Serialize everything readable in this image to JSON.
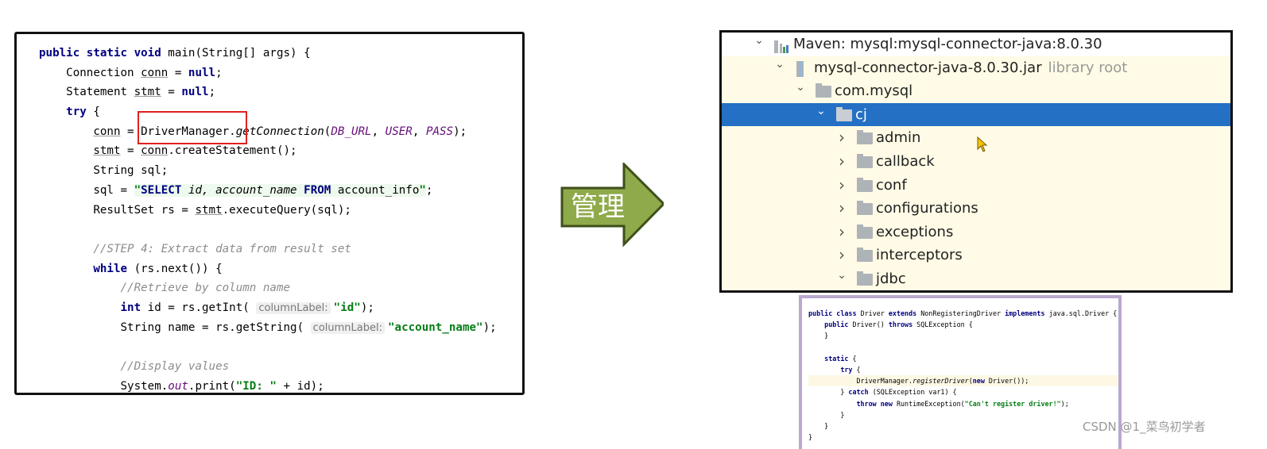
{
  "left_code": {
    "lines": [
      [
        [
          "public static void ",
          "kw"
        ],
        [
          "main(String[] args) {",
          ""
        ]
      ],
      [
        [
          "    Connection ",
          ""
        ],
        [
          "conn",
          "ul"
        ],
        [
          " = ",
          ""
        ],
        [
          "null",
          "kw"
        ],
        [
          ";",
          ""
        ]
      ],
      [
        [
          "    Statement ",
          ""
        ],
        [
          "stmt",
          "ul"
        ],
        [
          " = ",
          ""
        ],
        [
          "null",
          "kw"
        ],
        [
          ";",
          ""
        ]
      ],
      [
        [
          "    ",
          ""
        ],
        [
          "try",
          "kw"
        ],
        [
          " {",
          ""
        ]
      ],
      [
        [
          "        ",
          ""
        ],
        [
          "conn",
          "ul"
        ],
        [
          " = DriverManager.",
          ""
        ],
        [
          "getConnection",
          "it"
        ],
        [
          "(",
          ""
        ],
        [
          "DB_URL",
          "fld"
        ],
        [
          ", ",
          ""
        ],
        [
          "USER",
          "fld"
        ],
        [
          ", ",
          ""
        ],
        [
          "PASS",
          "fld"
        ],
        [
          ");",
          ""
        ]
      ],
      [
        [
          "        ",
          ""
        ],
        [
          "stmt",
          "ul"
        ],
        [
          " = ",
          ""
        ],
        [
          "conn",
          "ul"
        ],
        [
          ".createStatement();",
          ""
        ]
      ],
      [
        [
          "        String sql;",
          ""
        ]
      ],
      [
        [
          "        sql = ",
          ""
        ],
        [
          "\"",
          "strs"
        ],
        [
          "SELECT ",
          "sqlk"
        ],
        [
          "id, account_name ",
          "sqli"
        ],
        [
          "FROM ",
          "sqlk"
        ],
        [
          "account_info",
          "sqln"
        ],
        [
          "\"",
          "strs"
        ],
        [
          ";",
          ""
        ]
      ],
      [
        [
          "        ResultSet rs = ",
          ""
        ],
        [
          "stmt",
          "ul"
        ],
        [
          ".executeQuery(sql);",
          ""
        ]
      ],
      [
        [
          "",
          ""
        ]
      ],
      [
        [
          "        ",
          ""
        ],
        [
          "//STEP 4: Extract data from result set",
          "cm"
        ]
      ],
      [
        [
          "        ",
          ""
        ],
        [
          "while",
          "kw"
        ],
        [
          " (rs.next()) {",
          ""
        ]
      ],
      [
        [
          "            ",
          ""
        ],
        [
          "//Retrieve by column name",
          "cm"
        ]
      ],
      [
        [
          "            ",
          ""
        ],
        [
          "int",
          "kw"
        ],
        [
          " id = rs.getInt( ",
          ""
        ],
        [
          "columnLabel:",
          "hint"
        ],
        [
          "\"id\"",
          "str"
        ],
        [
          ");",
          ""
        ]
      ],
      [
        [
          "            String name = rs.getString( ",
          ""
        ],
        [
          "columnLabel:",
          "hint"
        ],
        [
          "\"account_name\"",
          "str"
        ],
        [
          ");",
          ""
        ]
      ],
      [
        [
          "",
          ""
        ]
      ],
      [
        [
          "            ",
          ""
        ],
        [
          "//Display values",
          "cm"
        ]
      ],
      [
        [
          "            System.",
          ""
        ],
        [
          "out",
          "fld"
        ],
        [
          ".print(",
          ""
        ],
        [
          "\"ID: \"",
          "str"
        ],
        [
          " + id);",
          ""
        ]
      ]
    ]
  },
  "arrow": {
    "label": "管理",
    "color": "#8faa4a"
  },
  "tree": {
    "rows": [
      {
        "label": "Maven: mysql:mysql-connector-java:8.0.30",
        "icon": "maven-library-icon",
        "chevron": "down",
        "level": 0
      },
      {
        "label": "mysql-connector-java-8.0.30.jar",
        "suffix": "library root",
        "icon": "jar-icon",
        "chevron": "down",
        "level": 1
      },
      {
        "label": "com.mysql",
        "icon": "folder-icon",
        "chevron": "down",
        "level": 2
      },
      {
        "label": "cj",
        "icon": "folder-icon",
        "chevron": "down",
        "level": 3,
        "selected": true
      },
      {
        "label": "admin",
        "icon": "folder-icon",
        "chevron": "right",
        "level": 4
      },
      {
        "label": "callback",
        "icon": "folder-icon",
        "chevron": "right",
        "level": 4
      },
      {
        "label": "conf",
        "icon": "folder-icon",
        "chevron": "right",
        "level": 4
      },
      {
        "label": "configurations",
        "icon": "folder-icon",
        "chevron": "right",
        "level": 4
      },
      {
        "label": "exceptions",
        "icon": "folder-icon",
        "chevron": "right",
        "level": 4
      },
      {
        "label": "interceptors",
        "icon": "folder-icon",
        "chevron": "right",
        "level": 4
      },
      {
        "label": "jdbc",
        "icon": "folder-icon",
        "chevron": "down",
        "level": 4
      }
    ]
  },
  "driver_code": {
    "lines": [
      [
        [
          "public class ",
          "kw"
        ],
        [
          "Driver ",
          ""
        ],
        [
          "extends ",
          "kw"
        ],
        [
          "NonRegisteringDriver ",
          ""
        ],
        [
          "implements ",
          "kw"
        ],
        [
          "java.sql.Driver {",
          ""
        ]
      ],
      [
        [
          "    ",
          ""
        ],
        [
          "public ",
          "kw"
        ],
        [
          "Driver() ",
          ""
        ],
        [
          "throws ",
          "kw"
        ],
        [
          "SQLException {",
          ""
        ]
      ],
      [
        [
          "    }",
          ""
        ]
      ],
      [
        [
          "",
          ""
        ]
      ],
      [
        [
          "    ",
          ""
        ],
        [
          "static ",
          "kw"
        ],
        [
          "{",
          ""
        ]
      ],
      [
        [
          "        ",
          ""
        ],
        [
          "try ",
          "kw"
        ],
        [
          "{",
          ""
        ]
      ],
      [
        [
          "            DriverManager.",
          ""
        ],
        [
          "registerDriver",
          "it"
        ],
        [
          "(",
          ""
        ],
        [
          "new ",
          "kw"
        ],
        [
          "Driver());",
          ""
        ]
      ],
      [
        [
          "        } ",
          ""
        ],
        [
          "catch ",
          "kw"
        ],
        [
          "(SQLException var1) {",
          ""
        ]
      ],
      [
        [
          "            ",
          ""
        ],
        [
          "throw new ",
          "kw"
        ],
        [
          "RuntimeException(",
          ""
        ],
        [
          "\"Can't register driver!\"",
          "str"
        ],
        [
          ");",
          ""
        ]
      ],
      [
        [
          "        }",
          ""
        ]
      ],
      [
        [
          "    }",
          ""
        ]
      ],
      [
        [
          "}",
          ""
        ]
      ]
    ]
  },
  "watermark": "CSDN @1_菜鸟初学者"
}
